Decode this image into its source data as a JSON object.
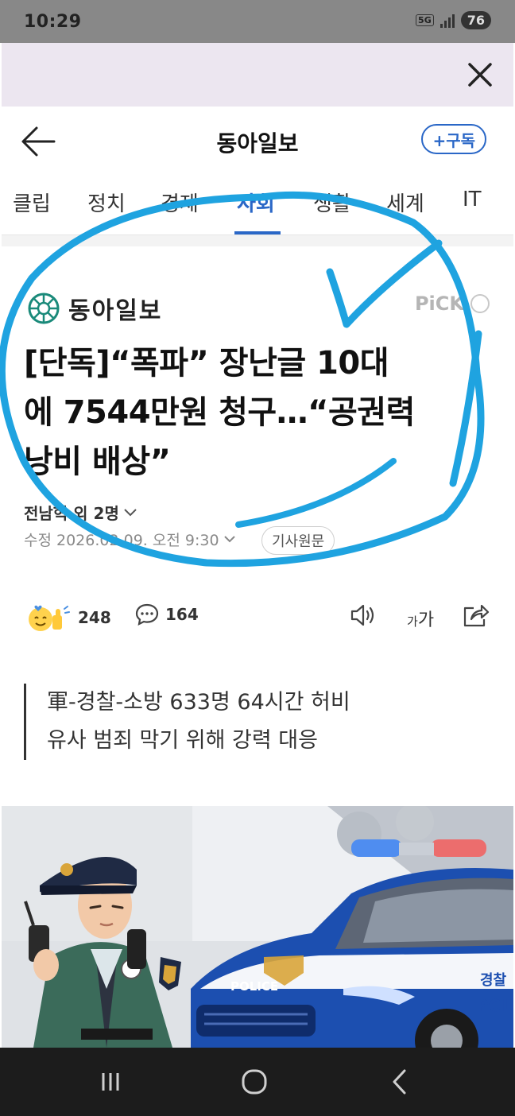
{
  "status_bar": {
    "time": "10:29",
    "network": "5G",
    "battery": "76"
  },
  "header": {
    "title": "동아일보",
    "subscribe_label": "+구독"
  },
  "tabs": [
    {
      "label": "클립"
    },
    {
      "label": "정치"
    },
    {
      "label": "경제"
    },
    {
      "label": "사회",
      "active": true
    },
    {
      "label": "생활"
    },
    {
      "label": "세계"
    },
    {
      "label": "IT"
    }
  ],
  "article": {
    "press": "동아일보",
    "pick_label": "PiCK",
    "headline_lines": [
      "[단독]“폭파” 장난글 10대",
      "에 7544만원 청구…“공권력",
      "낭비 배상”"
    ],
    "byline": "전남혁 외 2명",
    "updated": "수정 2026.02.09. 오전 9:30",
    "original_button": "기사원문",
    "reaction_count": "248",
    "comment_count": "164",
    "font_size_label_small": "가",
    "font_size_label_large": "가",
    "summary_lines": [
      "軍-경찰-소방 633명 64시간 허비",
      "유사 범죄 막기 위해 강력 대응"
    ]
  },
  "illustration": {
    "car_label": "POLICE",
    "car_side_text": "경찰",
    "car_side_label": "POLICE"
  },
  "colors": {
    "accent": "#2a67c7",
    "annotation": "#1fa3e0",
    "status_bar": "#888888",
    "nav_bar": "#1c1c1c"
  }
}
